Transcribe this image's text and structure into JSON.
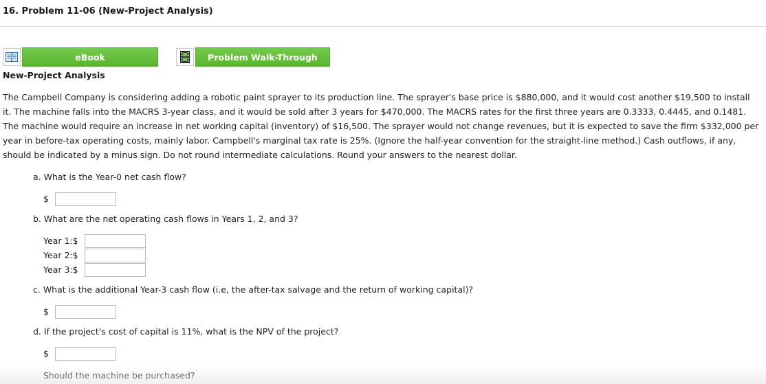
{
  "problem": {
    "title": "16. Problem 11-06 (New-Project Analysis)"
  },
  "toolbar": {
    "ebook_label": "eBook",
    "walkthrough_label": "Problem Walk-Through"
  },
  "section": {
    "heading": "New-Project Analysis",
    "text": "The Campbell Company is considering adding a robotic paint sprayer to its production line. The sprayer's base price is $880,000, and it would cost another $19,500 to install it. The machine falls into the MACRS 3-year class, and it would be sold after 3 years for $470,000. The MACRS rates for the first three years are 0.3333, 0.4445, and 0.1481. The machine would require an increase in net working capital (inventory) of $16,500. The sprayer would not change revenues, but it is expected to save the firm $332,000 per year in before-tax operating costs, mainly labor. Campbell's marginal tax rate is 25%. (Ignore the half-year convention for the straight-line method.) Cash outflows, if any, should be indicated by a minus sign. Do not round intermediate calculations. Round your answers to the nearest dollar."
  },
  "questions": {
    "a": {
      "text": "a. What is the Year-0 net cash flow?",
      "currency": "$",
      "value": ""
    },
    "b": {
      "text": "b. What are the net operating cash flows in Years 1, 2, and 3?",
      "rows": [
        {
          "label": "Year 1:$",
          "value": ""
        },
        {
          "label": "Year 2:$",
          "value": ""
        },
        {
          "label": "Year 3:$",
          "value": ""
        }
      ]
    },
    "c": {
      "text": "c. What is the additional Year-3 cash flow (i.e, the after-tax salvage and the return of working capital)?",
      "currency": "$",
      "value": ""
    },
    "d": {
      "text": "d. If the project's cost of capital is 11%, what is the NPV of the project?",
      "currency": "$",
      "value": ""
    },
    "e": {
      "text": "Should the machine be purchased?"
    }
  },
  "icons": {
    "ebook": "book-icon",
    "walkthrough": "film-icon"
  },
  "colors": {
    "button_green": "#5cb531",
    "button_text": "#ffffff"
  }
}
